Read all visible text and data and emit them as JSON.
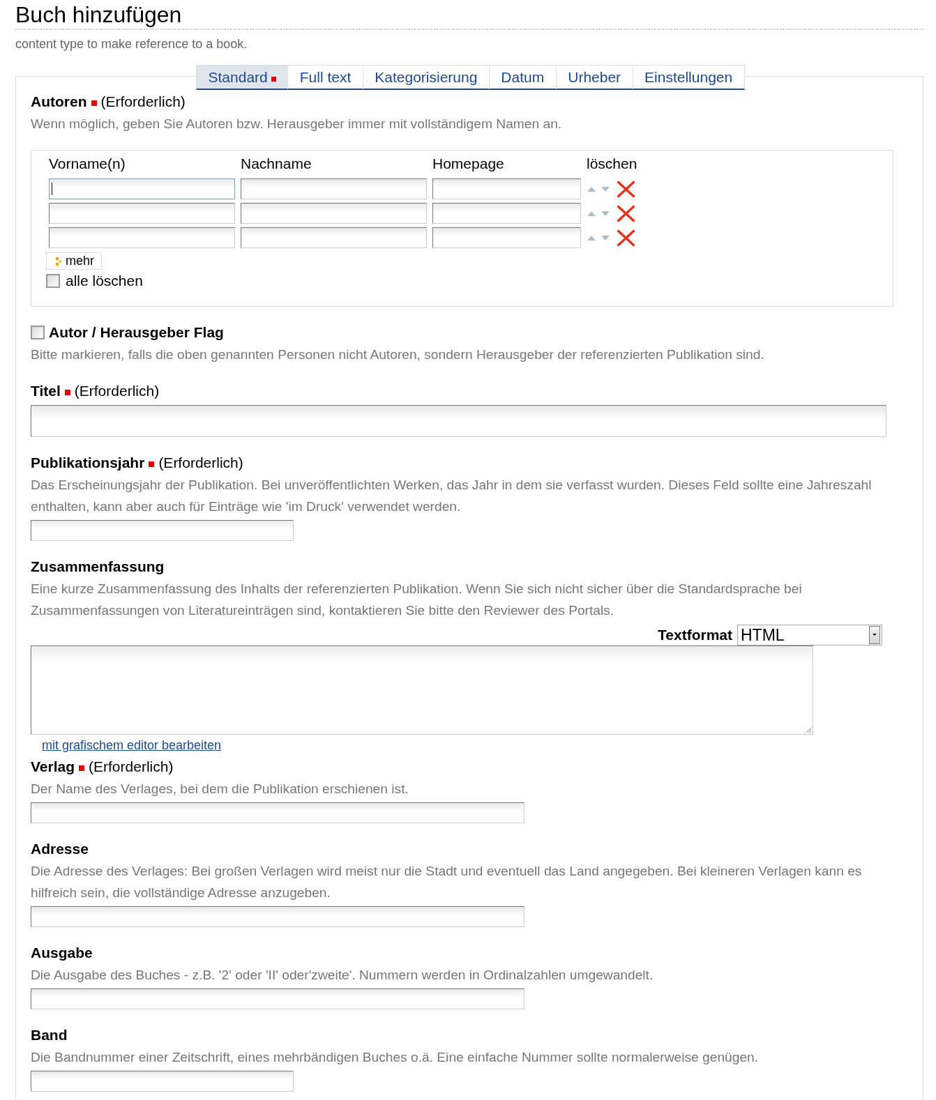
{
  "page": {
    "title": "Buch hinzufügen",
    "subtitle": "content type to make reference to a book."
  },
  "tabs": [
    {
      "label": "Standard",
      "selected": true,
      "required": true
    },
    {
      "label": "Full text",
      "selected": false
    },
    {
      "label": "Kategorisierung",
      "selected": false
    },
    {
      "label": "Datum",
      "selected": false
    },
    {
      "label": "Urheber",
      "selected": false
    },
    {
      "label": "Einstellungen",
      "selected": false
    }
  ],
  "fields": [
    {
      "kind": "authors",
      "label": "Autoren",
      "required": true,
      "note": "(Erforderlich)",
      "description": "Wenn möglich, geben Sie Autoren bzw. Herausgeber immer mit vollständigem Namen an.",
      "columns": [
        "Vorname(n)",
        "Nachname",
        "Homepage",
        "löschen"
      ],
      "rows": [
        [
          {
            "focused": true
          },
          {
            "focused": false
          },
          {
            "focused": false
          }
        ],
        [
          {
            "focused": false
          },
          {
            "focused": false
          },
          {
            "focused": false
          }
        ],
        [
          {
            "focused": false
          },
          {
            "focused": false
          },
          {
            "focused": false
          }
        ]
      ],
      "more_button": "mehr",
      "delete_all": {
        "label": "alle löschen",
        "checked": false
      }
    },
    {
      "kind": "checkbox",
      "label": "Autor / Herausgeber Flag",
      "checked": false,
      "description": "Bitte markieren, falls die oben genannten Personen nicht Autoren, sondern Herausgeber der referenzierten Publikation sind."
    },
    {
      "kind": "long",
      "label": "Titel",
      "required": true,
      "note": "(Erforderlich)"
    },
    {
      "kind": "short",
      "label": "Publikationsjahr",
      "required": true,
      "note": "(Erforderlich)",
      "description": "Das Erscheinungsjahr der Publikation. Bei unveröffentlichten Werken, das Jahr in dem sie verfasst wurden. Dieses Feld sollte eine Jahreszahl enthalten, kann aber auch für Einträge wie 'im Druck' verwendet werden."
    },
    {
      "kind": "textarea",
      "label": "Zusammenfassung",
      "description": "Eine kurze Zusammenfassung des Inhalts der referenzierten Publikation. Wenn Sie sich nicht sicher über die Standardsprache bei Zusammenfassungen von Literatureinträgen sind, kontaktieren Sie bitte den Reviewer des Portals.",
      "format_label": "Textformat",
      "format_value": "HTML",
      "editor_link": "mit grafischem editor bearbeiten"
    },
    {
      "kind": "text",
      "label": "Verlag",
      "required": true,
      "note": "(Erforderlich)",
      "description": "Der Name des Verlages, bei dem die Publikation erschienen ist."
    },
    {
      "kind": "text",
      "label": "Adresse",
      "description": "Die Adresse des Verlages: Bei großen Verlagen wird meist nur die Stadt und eventuell das Land angegeben. Bei kleineren Verlagen kann es hilfreich sein, die vollständige Adresse anzugeben."
    },
    {
      "kind": "text",
      "label": "Ausgabe",
      "description": "Die Ausgabe des Buches - z.B. '2' oder 'II' oder'zweite'. Nummern werden in Ordinalzahlen umgewandelt."
    },
    {
      "kind": "short",
      "label": "Band",
      "description": "Die Bandnummer einer Zeitschrift, eines mehrbändigen Buches o.ä. Eine einfache Nummer sollte normalerweise genügen."
    }
  ]
}
